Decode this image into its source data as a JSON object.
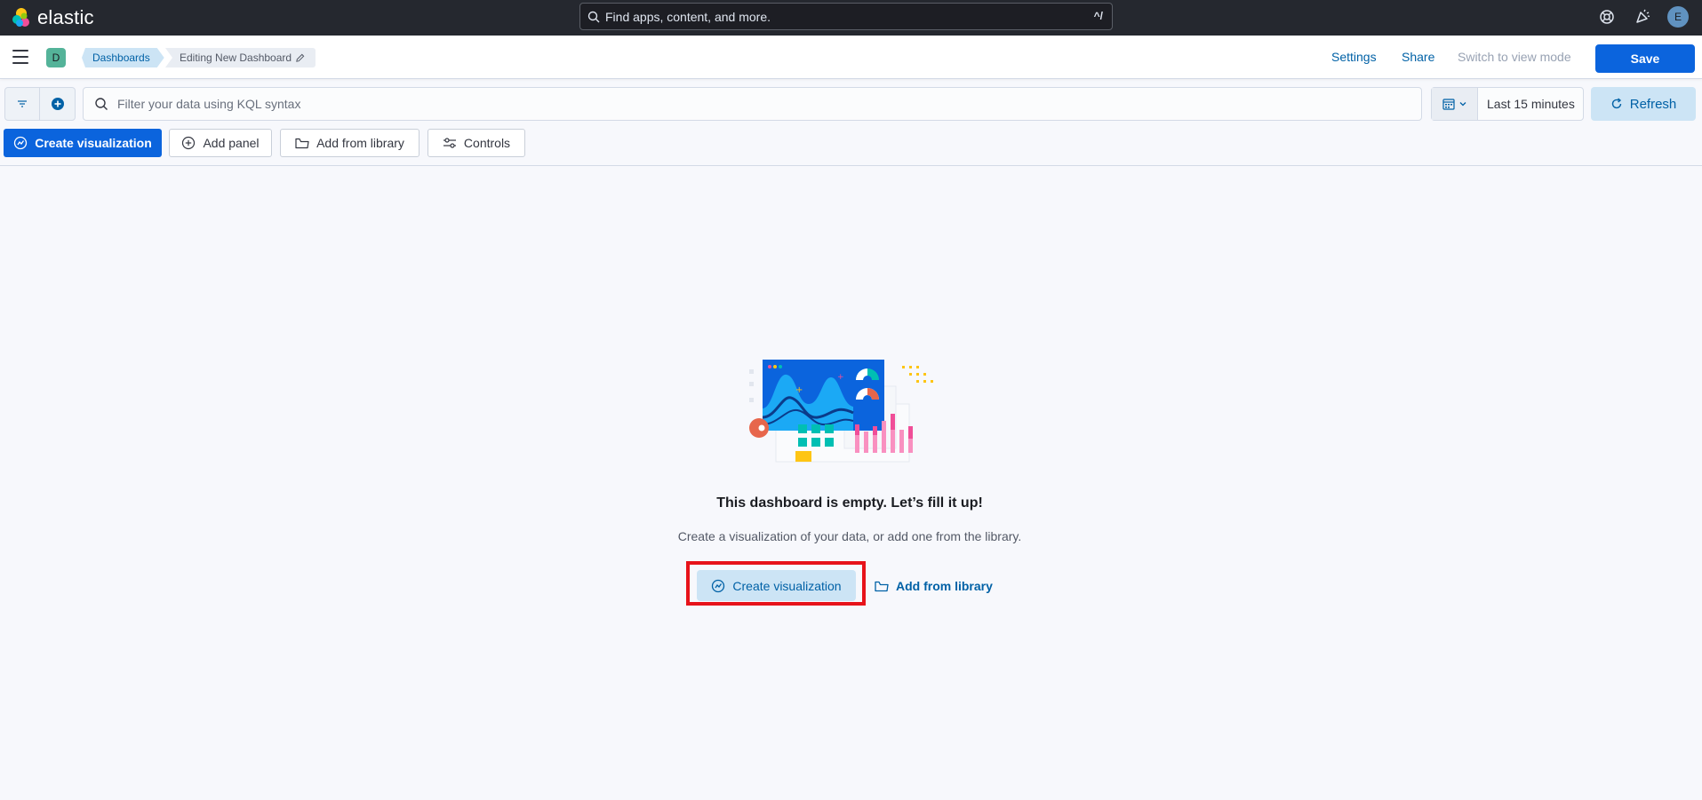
{
  "header": {
    "brand": "elastic",
    "search_placeholder": "Find apps, content, and more.",
    "search_shortcut": "^/",
    "help_icon": "help-icon",
    "news_icon": "newsfeed-icon",
    "user_initial": "E"
  },
  "nav": {
    "space_initial": "D",
    "breadcrumbs": [
      "Dashboards",
      "Editing New Dashboard"
    ],
    "links": {
      "settings": "Settings",
      "share": "Share",
      "switch_mode": "Switch to view mode",
      "save": "Save"
    }
  },
  "query": {
    "kql_placeholder": "Filter your data using KQL syntax",
    "time_range": "Last 15 minutes",
    "refresh": "Refresh"
  },
  "toolbar": {
    "create_visualization": "Create visualization",
    "add_panel": "Add panel",
    "add_from_library": "Add from library",
    "controls": "Controls"
  },
  "empty_state": {
    "title": "This dashboard is empty. Let’s fill it up!",
    "description": "Create a visualization of your data, or add one from the library.",
    "create_visualization": "Create visualization",
    "add_from_library": "Add from library"
  },
  "colors": {
    "header_bg": "#25282f",
    "primary": "#0b64dd",
    "primary_light": "#cce4f5",
    "link": "#0061a6",
    "highlight": "#e7131a"
  }
}
